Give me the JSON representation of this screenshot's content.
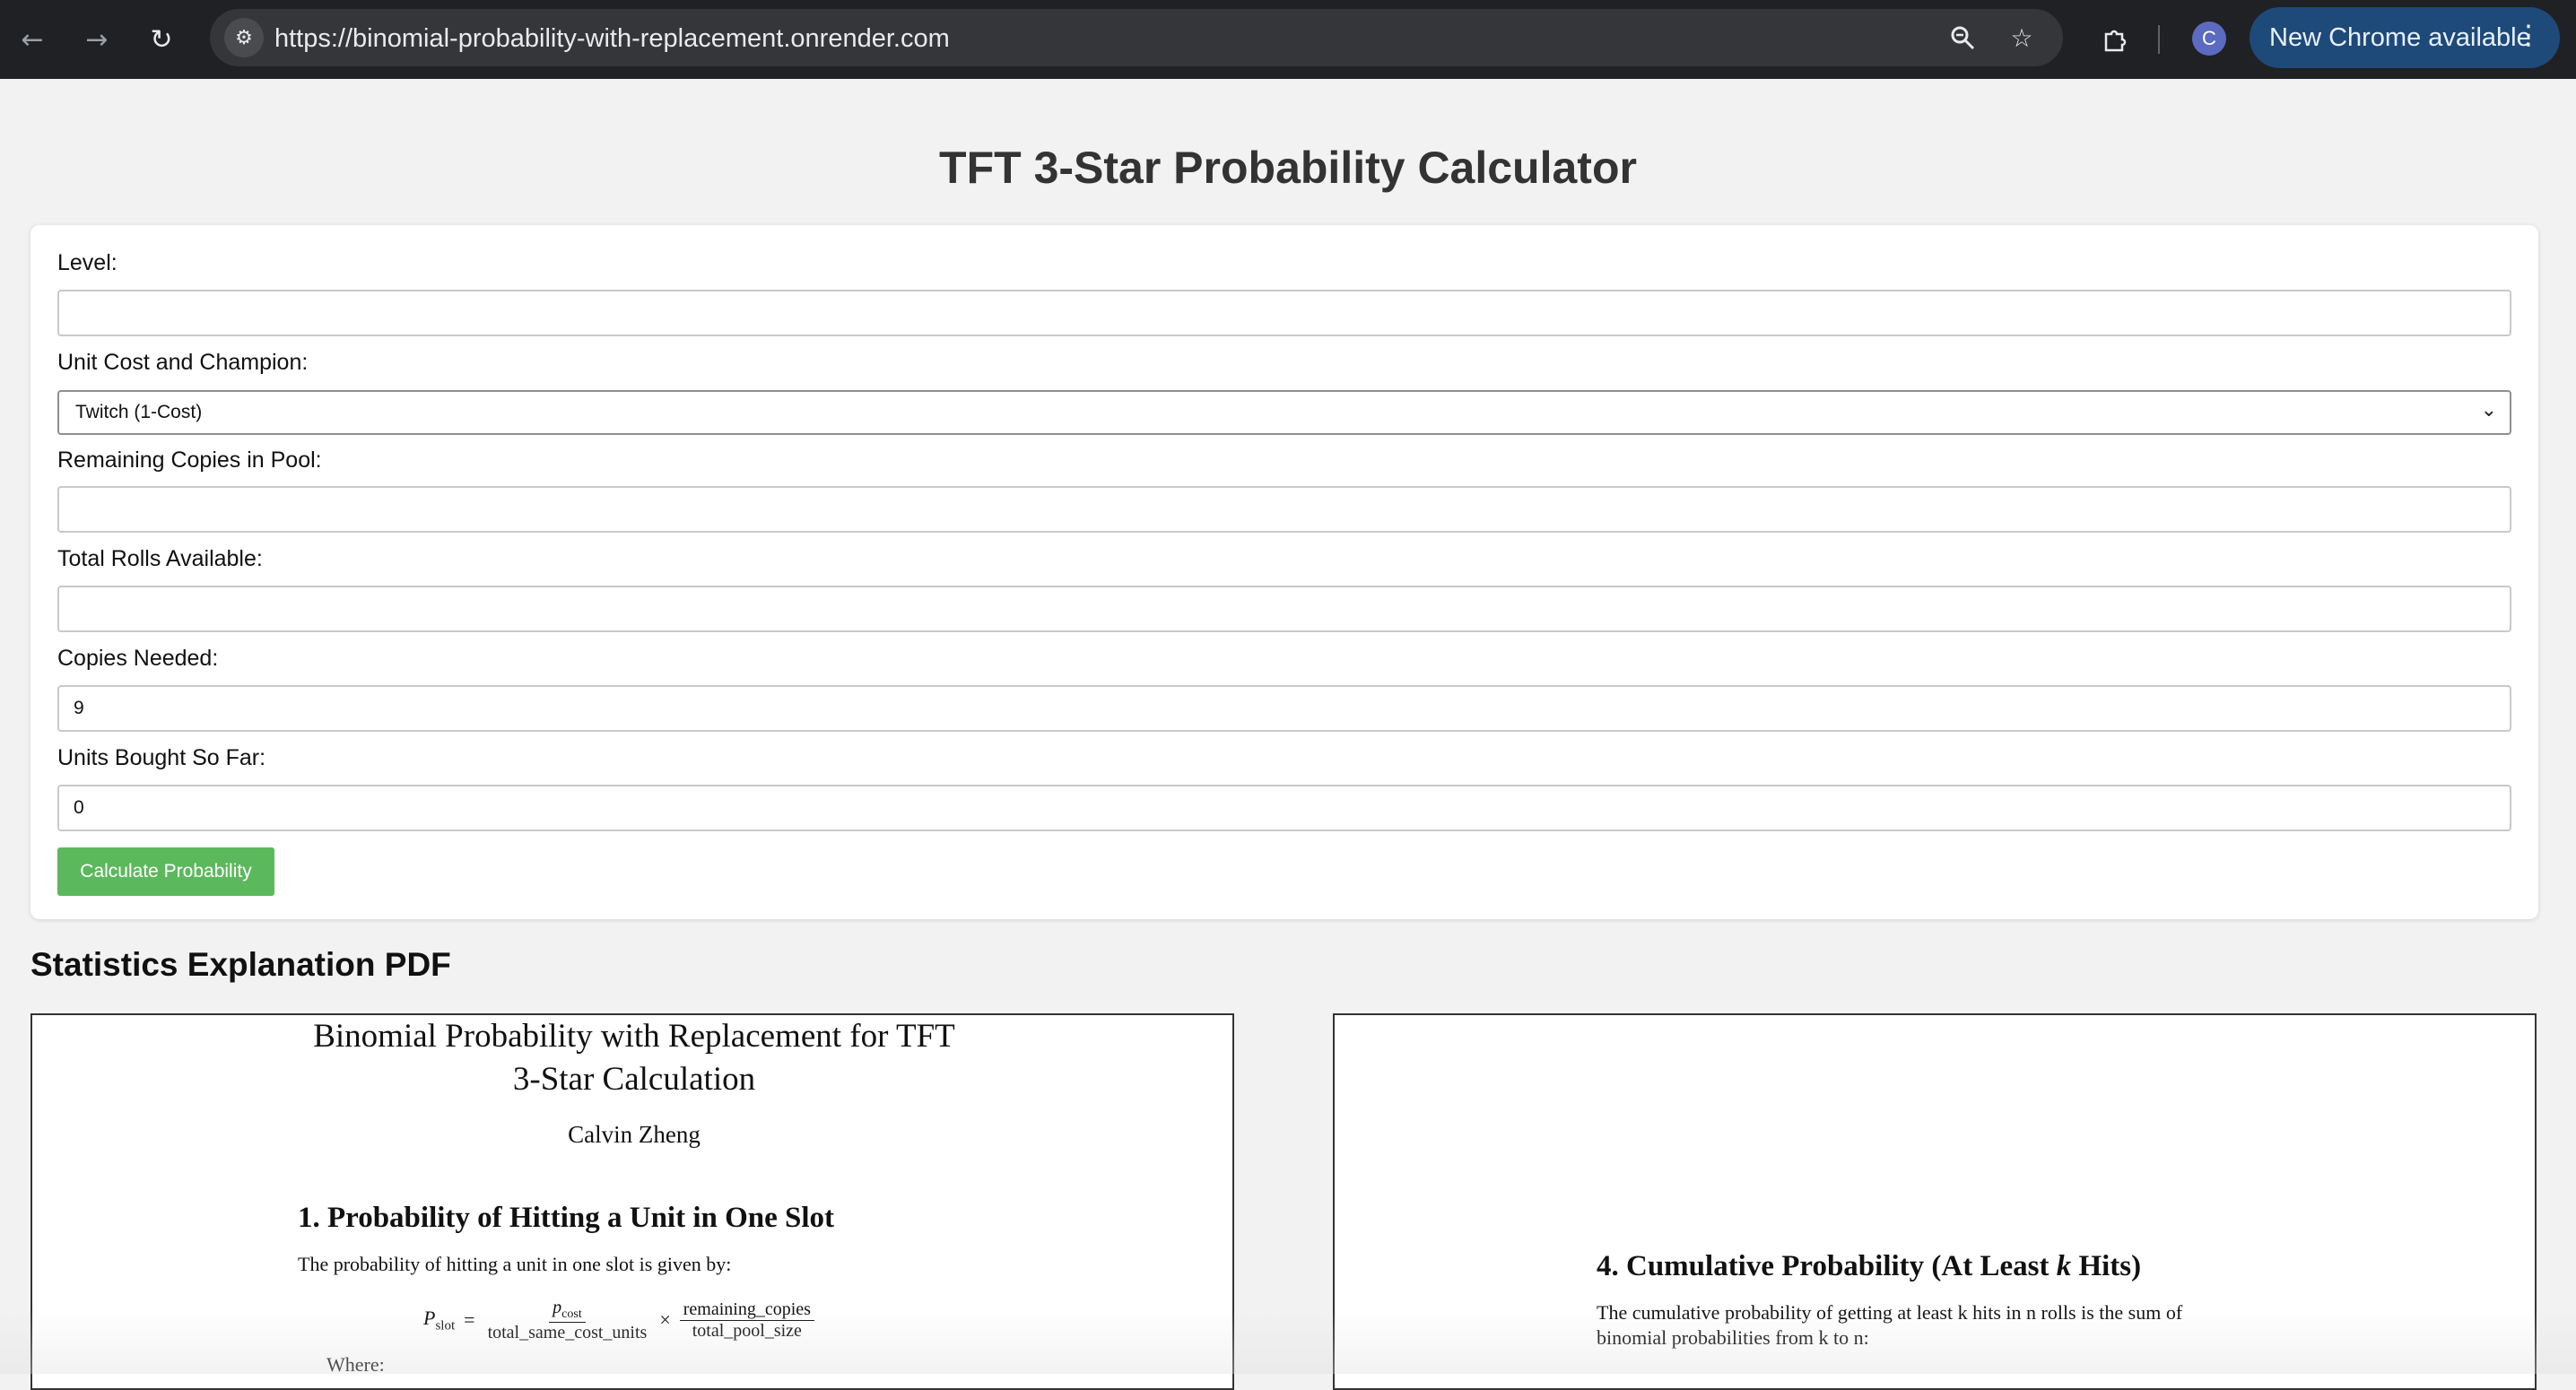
{
  "browser": {
    "url": "https://binomial-probability-with-replacement.onrender.com",
    "avatar_letter": "C",
    "update_label": "New Chrome available",
    "icons": {
      "back": "arrow-left-icon",
      "forward": "arrow-right-icon",
      "reload": "reload-icon",
      "site_info": "tune-icon",
      "zoom": "zoom-icon",
      "bookmark": "star-icon",
      "extensions": "puzzle-icon",
      "menu": "more-vertical-icon"
    }
  },
  "page": {
    "title": "TFT 3-Star Probability Calculator"
  },
  "form": {
    "level": {
      "label": "Level:",
      "value": ""
    },
    "unit": {
      "label": "Unit Cost and Champion:",
      "selected": "Twitch (1-Cost)"
    },
    "remaining": {
      "label": "Remaining Copies in Pool:",
      "value": ""
    },
    "rolls": {
      "label": "Total Rolls Available:",
      "value": ""
    },
    "copies_needed": {
      "label": "Copies Needed:",
      "value": "9"
    },
    "units_bought": {
      "label": "Units Bought So Far:",
      "value": "0"
    },
    "submit_label": "Calculate Probability"
  },
  "pdf": {
    "heading": "Statistics Explanation PDF",
    "page1": {
      "title_line1": "Binomial Probability with Replacement for TFT",
      "title_line2": "3-Star Calculation",
      "author": "Calvin Zheng",
      "section_title": "1.  Probability of Hitting a Unit in One Slot",
      "intro": "The probability of hitting a unit in one slot is given by:",
      "formula": {
        "lhs": "P",
        "lhs_sub": "slot",
        "equals": "=",
        "frac1_num": "p",
        "frac1_num_sub": "cost",
        "frac1_den": "total_same_cost_units",
        "times": "×",
        "frac2_num": "remaining_copies",
        "frac2_den": "total_pool_size"
      },
      "where": "Where:"
    },
    "page2": {
      "section_title_pre": "4.  Cumulative Probability (At Least ",
      "section_title_var": "k",
      "section_title_post": " Hits)",
      "line1": "The cumulative probability of getting at least k hits in n rolls is the sum of",
      "line2": "binomial probabilities from k to n:"
    }
  }
}
